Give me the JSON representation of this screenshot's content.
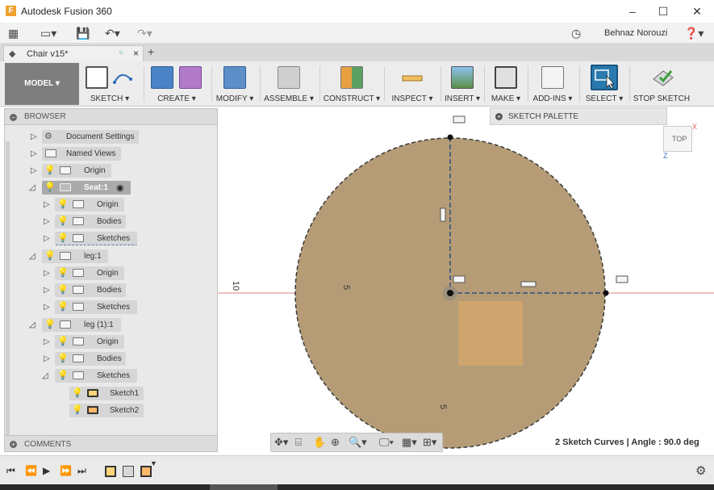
{
  "window": {
    "title": "Autodesk Fusion 360",
    "app_icon": "F"
  },
  "qat": {
    "user": "Behnaz Norouzi"
  },
  "tabs": {
    "document": "Chair v15*"
  },
  "ribbon": {
    "workspace": "MODEL ▾",
    "groups": [
      {
        "label": "SKETCH ▾"
      },
      {
        "label": "CREATE ▾"
      },
      {
        "label": "MODIFY ▾"
      },
      {
        "label": "ASSEMBLE ▾"
      },
      {
        "label": "CONSTRUCT ▾"
      },
      {
        "label": "INSPECT ▾"
      },
      {
        "label": "INSERT ▾"
      },
      {
        "label": "MAKE ▾"
      },
      {
        "label": "ADD-INS ▾"
      },
      {
        "label": "SELECT ▾"
      },
      {
        "label": "STOP SKETCH"
      }
    ]
  },
  "browser": {
    "title": "BROWSER",
    "rows": [
      {
        "label": "Document Settings"
      },
      {
        "label": "Named Views"
      },
      {
        "label": "Origin"
      },
      {
        "label": "Seat:1"
      },
      {
        "label": "Origin"
      },
      {
        "label": "Bodies"
      },
      {
        "label": "Sketches"
      },
      {
        "label": "leg:1"
      },
      {
        "label": "Origin"
      },
      {
        "label": "Bodies"
      },
      {
        "label": "Sketches"
      },
      {
        "label": "leg (1):1"
      },
      {
        "label": "Origin"
      },
      {
        "label": "Bodies"
      },
      {
        "label": "Sketches"
      },
      {
        "label": "Sketch1"
      },
      {
        "label": "Sketch2"
      }
    ]
  },
  "comments": {
    "title": "COMMENTS"
  },
  "palette": {
    "title": "SKETCH PALETTE"
  },
  "viewcube": {
    "face": "TOP",
    "axis_z": "Z",
    "axis_x": "X"
  },
  "canvas": {
    "dim_left": "10",
    "dim_radius_h": "5",
    "dim_radius_v": "5"
  },
  "status": "2 Sketch Curves | Angle : 90.0 deg",
  "colors": {
    "disk_fill": "#b59c76",
    "disk_stroke": "#3a3a3a",
    "highlight": "#e8b26a",
    "axis_red": "#e06060",
    "constraint_blue": "#2f4f7f"
  }
}
